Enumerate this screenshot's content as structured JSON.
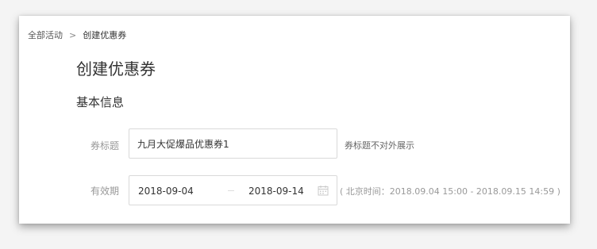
{
  "breadcrumb": {
    "parent": "全部活动",
    "separator": ">",
    "current": "创建优惠券"
  },
  "page": {
    "title": "创建优惠券",
    "section_title": "基本信息"
  },
  "form": {
    "coupon_title": {
      "label": "券标题",
      "value": "九月大促爆品优惠券1",
      "hint": "券标题不对外展示"
    },
    "validity": {
      "label": "有效期",
      "start_date": "2018-09-04",
      "end_date": "2018-09-14",
      "hint": "( 北京时间：2018.09.04 15:00 - 2018.09.15 14:59 )",
      "icon": "calendar-icon"
    }
  }
}
